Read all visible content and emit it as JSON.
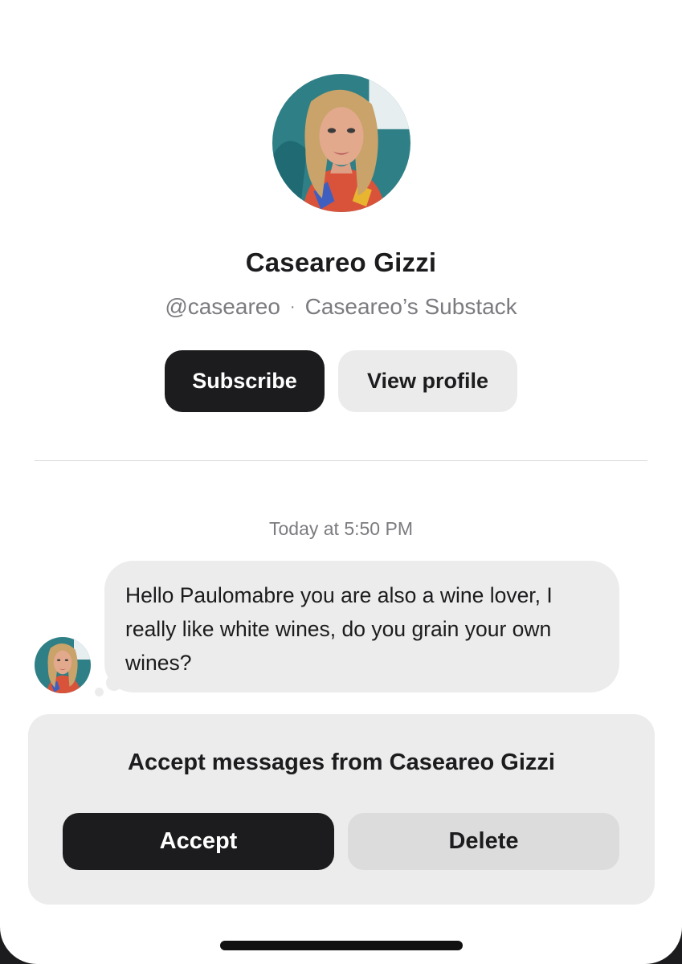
{
  "profile": {
    "name": "Caseareo Gizzi",
    "handle": "@caseareo",
    "separator": "·",
    "publication": "Caseareo’s Substack",
    "avatar_icon": "profile-photo"
  },
  "actions": {
    "subscribe_label": "Subscribe",
    "view_profile_label": "View profile"
  },
  "conversation": {
    "timestamp": "Today at 5:50 PM",
    "messages": [
      {
        "sender": "Caseareo Gizzi",
        "text": "Hello Paulomabre you are also a wine lover, I really like white wines, do you grain your own wines?"
      }
    ]
  },
  "request_panel": {
    "title": "Accept messages from Caseareo Gizzi",
    "accept_label": "Accept",
    "delete_label": "Delete"
  },
  "colors": {
    "primary_button": "#1c1c1e",
    "secondary_button": "#ebebeb",
    "bubble": "#ececec",
    "muted_text": "#7b7b80"
  }
}
